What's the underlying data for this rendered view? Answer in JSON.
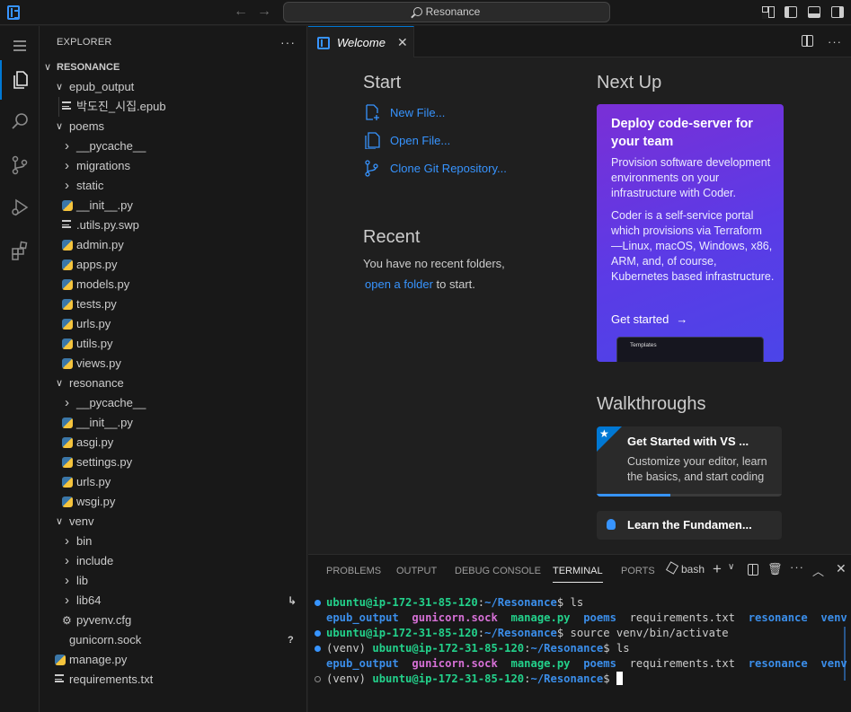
{
  "window": {
    "search_text": "Resonance"
  },
  "explorer": {
    "header": "EXPLORER",
    "more": "···",
    "root": "RESONANCE",
    "rows": [
      {
        "label": "epub_output",
        "kind": "folder-open",
        "depth": 1
      },
      {
        "label": "박도진_시집.epub",
        "kind": "lines",
        "depth": 2
      },
      {
        "label": "poems",
        "kind": "folder-open",
        "depth": 1
      },
      {
        "label": "__pycache__",
        "kind": "folder",
        "depth": 2
      },
      {
        "label": "migrations",
        "kind": "folder",
        "depth": 2
      },
      {
        "label": "static",
        "kind": "folder",
        "depth": 2
      },
      {
        "label": "__init__.py",
        "kind": "py",
        "depth": 2
      },
      {
        "label": ".utils.py.swp",
        "kind": "lines",
        "depth": 2
      },
      {
        "label": "admin.py",
        "kind": "py",
        "depth": 2
      },
      {
        "label": "apps.py",
        "kind": "py",
        "depth": 2
      },
      {
        "label": "models.py",
        "kind": "py",
        "depth": 2
      },
      {
        "label": "tests.py",
        "kind": "py",
        "depth": 2
      },
      {
        "label": "urls.py",
        "kind": "py",
        "depth": 2
      },
      {
        "label": "utils.py",
        "kind": "py",
        "depth": 2
      },
      {
        "label": "views.py",
        "kind": "py",
        "depth": 2
      },
      {
        "label": "resonance",
        "kind": "folder-open",
        "depth": 1
      },
      {
        "label": "__pycache__",
        "kind": "folder",
        "depth": 2
      },
      {
        "label": "__init__.py",
        "kind": "py",
        "depth": 2
      },
      {
        "label": "asgi.py",
        "kind": "py",
        "depth": 2
      },
      {
        "label": "settings.py",
        "kind": "py",
        "depth": 2
      },
      {
        "label": "urls.py",
        "kind": "py",
        "depth": 2
      },
      {
        "label": "wsgi.py",
        "kind": "py",
        "depth": 2
      },
      {
        "label": "venv",
        "kind": "folder-open",
        "depth": 1
      },
      {
        "label": "bin",
        "kind": "folder",
        "depth": 2
      },
      {
        "label": "include",
        "kind": "folder",
        "depth": 2
      },
      {
        "label": "lib",
        "kind": "folder",
        "depth": 2
      },
      {
        "label": "lib64",
        "kind": "folder",
        "depth": 2,
        "badge": "↳"
      },
      {
        "label": "pyvenv.cfg",
        "kind": "gear",
        "depth": 2
      },
      {
        "label": "gunicorn.sock",
        "kind": "plain",
        "depth": 1,
        "badge": "?"
      },
      {
        "label": "manage.py",
        "kind": "py",
        "depth": 1
      },
      {
        "label": "requirements.txt",
        "kind": "lines",
        "depth": 1
      }
    ]
  },
  "editor": {
    "tab_label": "Welcome",
    "tab_close": "✕"
  },
  "welcome": {
    "start_title": "Start",
    "new_file": "New File...",
    "open_file": "Open File...",
    "clone_repo": "Clone Git Repository...",
    "recent_title": "Recent",
    "recent_text": "You have no recent folders,",
    "open_folder_link": "open a folder",
    "to_start": " to start.",
    "next_up_title": "Next Up",
    "promo_title": "Deploy code-server for your team",
    "promo_desc1": "Provision software development environments on your infrastructure with Coder.",
    "promo_desc2": "Coder is a self-service portal which provisions via Terraform —Linux, macOS, Windows, x86, ARM, and, of course, Kubernetes based infrastructure.",
    "promo_cta": "Get started",
    "promo_thumb": "Templates",
    "walkthroughs_title": "Walkthroughs",
    "wt1_title": "Get Started with VS ...",
    "wt1_desc": "Customize your editor, learn the basics, and start coding",
    "wt1_progress": 0.4,
    "wt2_title": "Learn the Fundamen..."
  },
  "panel": {
    "tabs": [
      "PROBLEMS",
      "OUTPUT",
      "DEBUG CONSOLE",
      "TERMINAL",
      "PORTS"
    ],
    "active_tab": "TERMINAL",
    "shell": "bash"
  },
  "terminal": {
    "user_host": "ubuntu@ip-172-31-85-120",
    "cwd": "~/Resonance",
    "cmd1": "ls",
    "ls_items": [
      "epub_output",
      "gunicorn.sock",
      "manage.py",
      "poems",
      "requirements.txt",
      "resonance",
      "venv"
    ],
    "cmd2": "source venv/bin/activate",
    "venv_prefix": "(venv) ",
    "cmd3": "ls"
  },
  "colors": {
    "accent": "#0078d4",
    "link": "#3794ff",
    "terminal_green": "#23d18b",
    "terminal_blue": "#3b8eea",
    "terminal_magenta": "#d670d6",
    "terminal_yellow": "#e5e510"
  }
}
